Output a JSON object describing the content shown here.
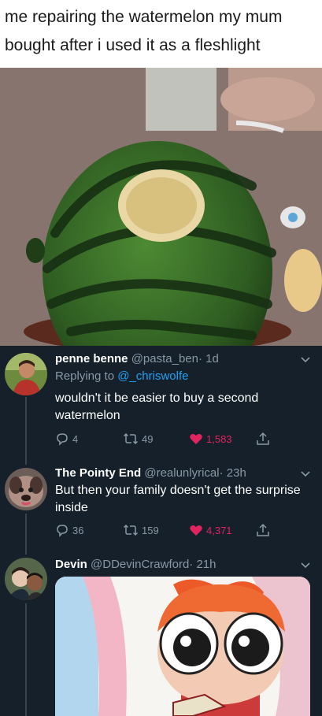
{
  "meme": {
    "caption": "me repairing the watermelon my mum bought after i used it as a fleshlight"
  },
  "tweets": [
    {
      "name": "penne benne",
      "handle": "@pasta_ben",
      "time": "· 1d",
      "reply_prefix": "Replying to ",
      "reply_to": "@_chriswolfe",
      "text": "wouldn't it be easier to buy a second watermelon",
      "replies": "4",
      "retweets": "49",
      "likes": "1,583",
      "liked": true
    },
    {
      "name": "The Pointy End",
      "handle": "@realunlyrical",
      "time": "· 23h",
      "text": "But then your family doesn't get the surprise inside",
      "replies": "36",
      "retweets": "159",
      "likes": "4,371",
      "liked": true
    },
    {
      "name": "Devin",
      "handle": "@DDevinCrawford",
      "time": "· 21h",
      "has_media": true
    }
  ],
  "icons": {
    "reply": "speech-bubble-icon",
    "retweet": "retweet-icon",
    "like": "heart-icon",
    "share": "share-icon",
    "more": "chevron-down-icon"
  },
  "colors": {
    "background": "#15202b",
    "secondary_text": "#8899a6",
    "link": "#1da1f2",
    "like": "#e0245e",
    "thread_line": "#38444d"
  }
}
